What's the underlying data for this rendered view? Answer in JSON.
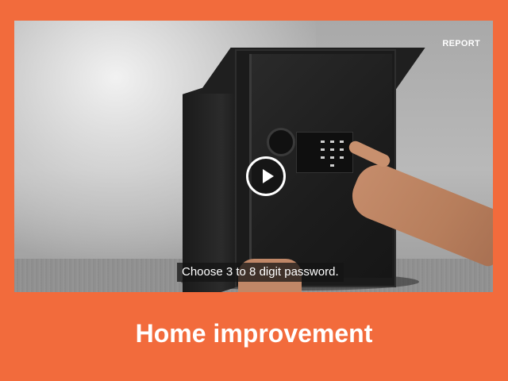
{
  "video": {
    "report_label": "REPORT",
    "caption": "Choose 3 to 8 digit password.",
    "play_icon": "play-icon"
  },
  "category": {
    "title": "Home improvement"
  },
  "colors": {
    "background": "#f26b3c",
    "text": "#ffffff"
  }
}
